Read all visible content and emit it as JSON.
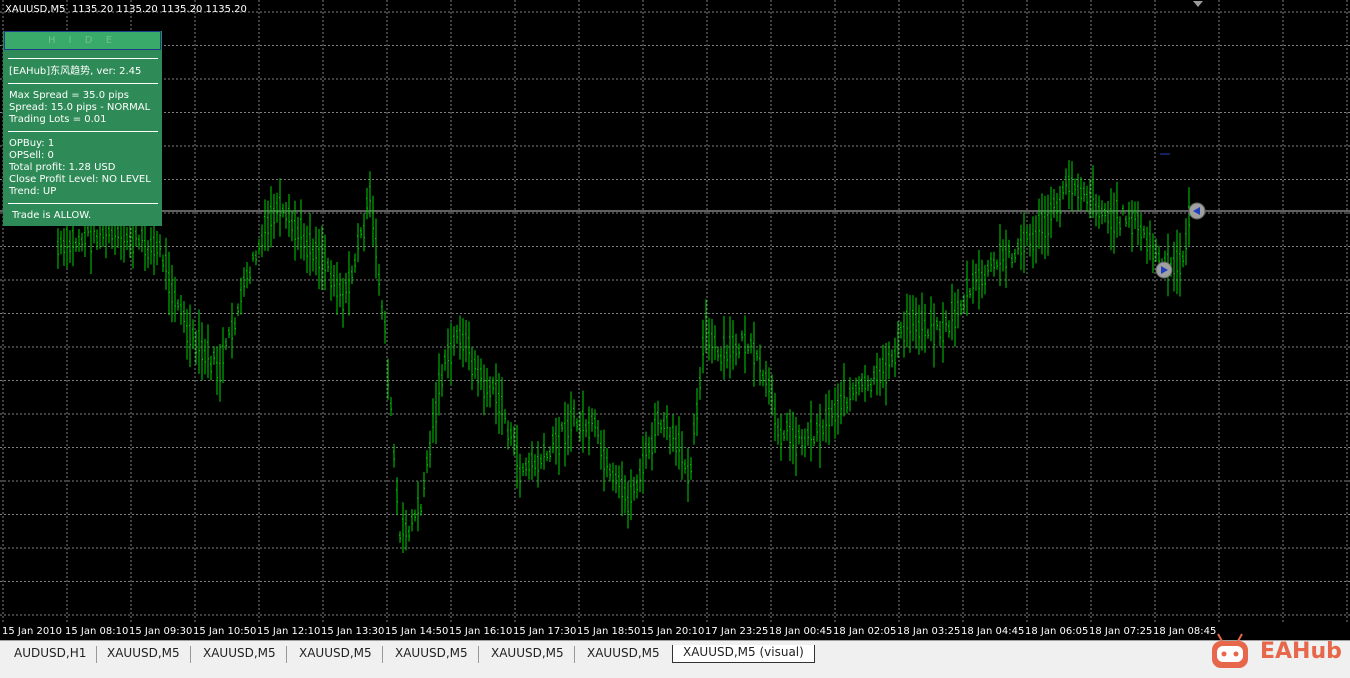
{
  "chart": {
    "title": "XAUUSD,M5  1135.20 1135.20 1135.20 1135.20",
    "colors": {
      "background": "#000000",
      "grid": "#7f7f7f",
      "candles": "#00d000",
      "bid_line": "#c0c0c0"
    },
    "x_labels": [
      "15 Jan 2010",
      "15 Jan 08:10",
      "15 Jan 09:30",
      "15 Jan 10:50",
      "15 Jan 12:10",
      "15 Jan 13:30",
      "15 Jan 14:50",
      "15 Jan 16:10",
      "15 Jan 17:30",
      "15 Jan 18:50",
      "15 Jan 20:10",
      "17 Jan 23:25",
      "18 Jan 00:45",
      "18 Jan 02:05",
      "18 Jan 03:25",
      "18 Jan 04:45",
      "18 Jan 06:05",
      "18 Jan 07:25",
      "18 Jan 08:45"
    ],
    "markers": [
      {
        "name": "sell-arrow-icon",
        "type": "sell"
      },
      {
        "name": "buy-arrow-icon",
        "type": "buy"
      }
    ]
  },
  "panel": {
    "hide_label": "H I D E",
    "version_line": "[EAHub]东风趋势, ver: 2.45",
    "max_spread": "Max Spread = 35.0 pips",
    "spread": "Spread: 15.0 pips - NORMAL",
    "trading_lots": "Trading Lots = 0.01",
    "op_buy": "OPBuy: 1",
    "op_sell": "OPSell: 0",
    "total_profit": "Total profit: 1.28 USD",
    "close_profit": "Close Profit Level: NO LEVEL",
    "trend": "Trend: UP",
    "trade_status": "Trade is ALLOW."
  },
  "tabs": [
    {
      "label": "AUDUSD,H1",
      "active": false
    },
    {
      "label": "XAUUSD,M5",
      "active": false
    },
    {
      "label": "XAUUSD,M5",
      "active": false
    },
    {
      "label": "XAUUSD,M5",
      "active": false
    },
    {
      "label": "XAUUSD,M5",
      "active": false
    },
    {
      "label": "XAUUSD,M5",
      "active": false
    },
    {
      "label": "XAUUSD,M5",
      "active": false
    },
    {
      "label": "XAUUSD,M5 (visual)",
      "active": true
    }
  ],
  "logo": {
    "text": "EAHub",
    "color": "#e7674a"
  }
}
